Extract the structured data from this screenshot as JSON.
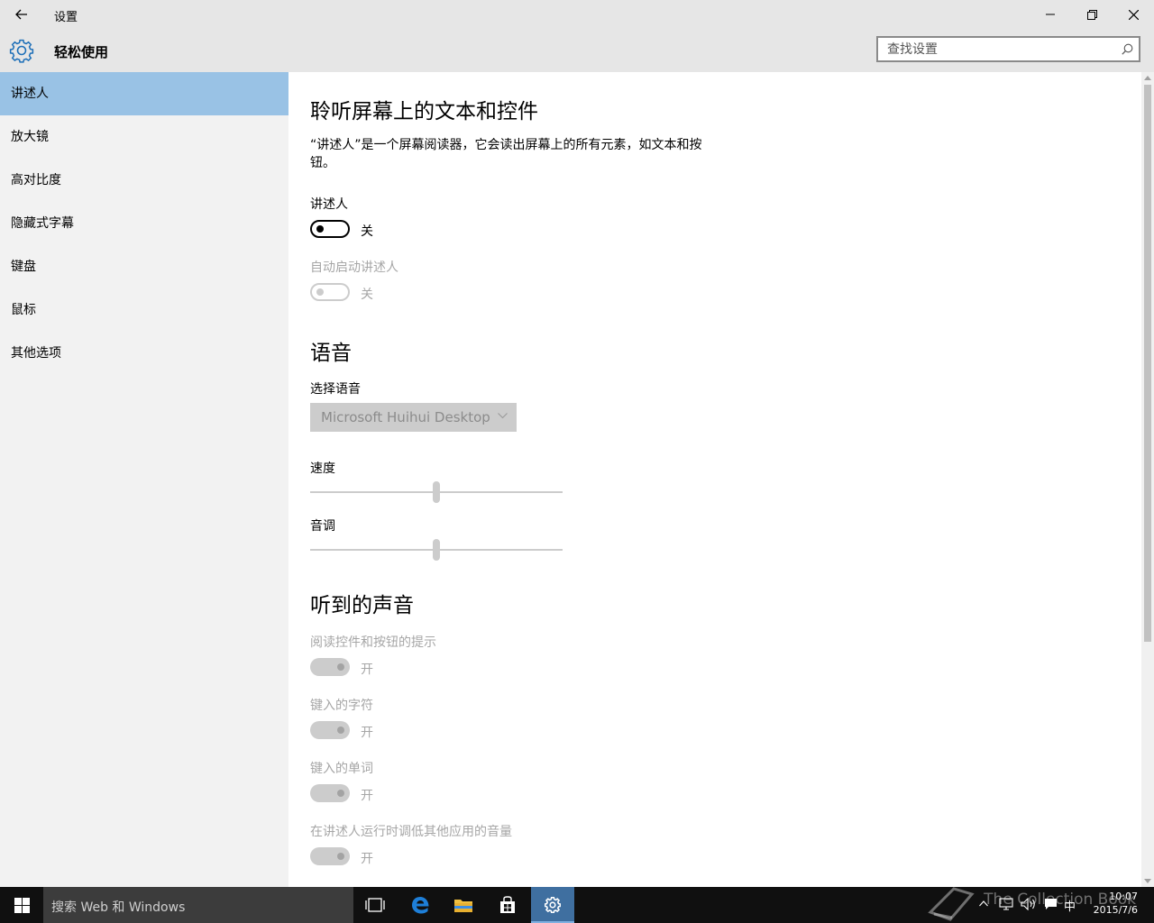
{
  "window": {
    "title": "设置",
    "minimize_glyph": "–",
    "colors": {
      "titlebar": "#e6e6e6",
      "sidebar": "#f2f2f2",
      "accent_selected": "#99c2e5",
      "taskbar": "#101010"
    }
  },
  "header": {
    "title": "轻松使用",
    "search_placeholder": "查找设置"
  },
  "sidebar": {
    "items": [
      {
        "label": "讲述人",
        "selected": true
      },
      {
        "label": "放大镜",
        "selected": false
      },
      {
        "label": "高对比度",
        "selected": false
      },
      {
        "label": "隐藏式字幕",
        "selected": false
      },
      {
        "label": "键盘",
        "selected": false
      },
      {
        "label": "鼠标",
        "selected": false
      },
      {
        "label": "其他选项",
        "selected": false
      }
    ]
  },
  "main": {
    "heading": "聆听屏幕上的文本和控件",
    "description": "“讲述人”是一个屏幕阅读器，它会读出屏幕上的所有元素，如文本和按钮。",
    "narrator": {
      "label": "讲述人",
      "state": "关",
      "on": false,
      "enabled": true
    },
    "auto_start": {
      "label": "自动启动讲述人",
      "state": "关",
      "on": false,
      "enabled": false
    },
    "voice_section": {
      "heading": "语音",
      "select_label": "选择语音",
      "selected_voice": "Microsoft Huihui Desktop",
      "speed_label": "速度",
      "speed_value": 0.5,
      "pitch_label": "音调",
      "pitch_value": 0.5
    },
    "sounds_section": {
      "heading": "听到的声音",
      "items": [
        {
          "label": "阅读控件和按钮的提示",
          "state": "开",
          "on": true,
          "enabled": false
        },
        {
          "label": "键入的字符",
          "state": "开",
          "on": true,
          "enabled": false
        },
        {
          "label": "键入的单词",
          "state": "开",
          "on": true,
          "enabled": false
        },
        {
          "label": "在讲述人运行时调低其他应用的音量",
          "state": "开",
          "on": true,
          "enabled": false
        }
      ]
    }
  },
  "taskbar": {
    "search_text": "搜索 Web 和 Windows",
    "icons": [
      "windows-logo-icon",
      "task-view-icon",
      "edge-icon",
      "file-explorer-icon",
      "store-icon",
      "settings-icon"
    ],
    "tray": {
      "ime": "中",
      "time": "10:07",
      "date": "2015/7/6"
    },
    "watermark": "The Collection Book"
  }
}
